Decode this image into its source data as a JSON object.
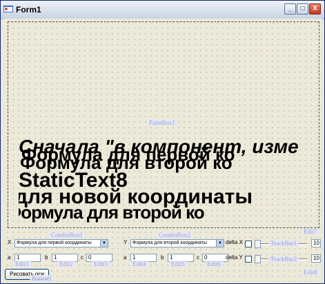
{
  "window": {
    "title": "Form1",
    "minimize": "_",
    "maximize": "□",
    "close": "X"
  },
  "paintbox": {
    "label": "PaintBox1"
  },
  "big_text": {
    "line1a": "Сначала \"в компонент, изме",
    "line1b": "Формула для первой ко",
    "line2a": "Формула для второй ко",
    "line3": "StaticText8",
    "line4": "для новой координаты"
  },
  "ghosts": {
    "combobox1": "ComboBox1",
    "combobox2": "ComboBox2",
    "edit7": "Edit7",
    "edit8": "Edit8",
    "edit1": "Edit1",
    "edit2": "Edit2",
    "edit3": "Edit3",
    "edit4": "Edit4",
    "edit5": "Edit5",
    "edit6": "Edit6",
    "trackbar1": "TrackBar1",
    "trackbar2": "TrackBar2",
    "button1": "Button1"
  },
  "row1": {
    "x_label": "X",
    "combo1_value": "Формула для первой координаты",
    "y_label": "Y",
    "combo2_value": "Формула для второй координаты",
    "delta_x_label": "delta X",
    "edit7_value": "10"
  },
  "row2": {
    "a1": "a",
    "a1_value": "1",
    "b1": "b",
    "b1_value": "1",
    "c1": "c",
    "c1_value": "0",
    "a2": "a",
    "a2_value": "1",
    "b2": "b",
    "b2_value": "1",
    "c2": "c",
    "c2_value": "0",
    "delta_y_label": "delta Y",
    "edit8_value": "10"
  },
  "button": {
    "label": "Рисовать оси"
  },
  "colors": {
    "accent": "#0a246a",
    "close": "#c2361b"
  },
  "icons": {
    "app": "delphi-form-icon",
    "minimize": "minimize-icon",
    "maximize": "maximize-icon",
    "close": "close-icon"
  }
}
